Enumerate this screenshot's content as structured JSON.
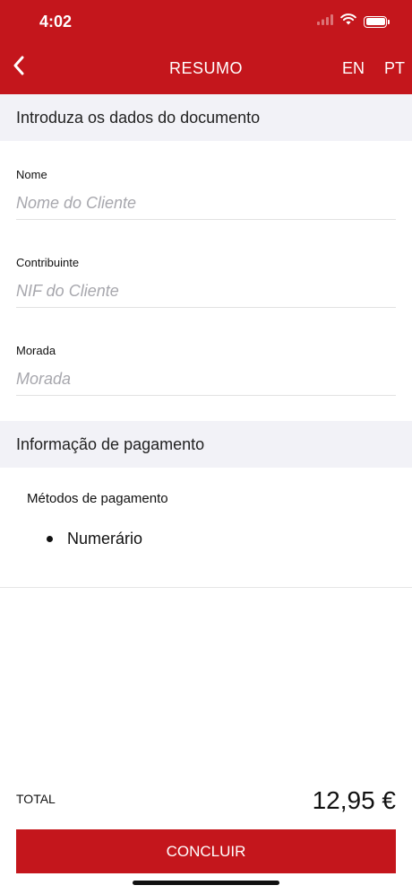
{
  "status_bar": {
    "time": "4:02"
  },
  "nav": {
    "title": "RESUMO",
    "lang_en": "EN",
    "lang_pt": "PT"
  },
  "document_section": {
    "header": "Introduza os dados do documento",
    "fields": [
      {
        "label": "Nome",
        "placeholder": "Nome do Cliente",
        "value": ""
      },
      {
        "label": "Contribuinte",
        "placeholder": "NIF do Cliente",
        "value": ""
      },
      {
        "label": "Morada",
        "placeholder": "Morada",
        "value": ""
      }
    ]
  },
  "payment_section": {
    "header": "Informação de pagamento",
    "methods_label": "Métodos de pagamento",
    "methods": [
      "Numerário"
    ]
  },
  "total": {
    "label": "TOTAL",
    "value": "12,95 €"
  },
  "action": {
    "conclude_label": "CONCLUIR"
  },
  "colors": {
    "brand": "#c4161c",
    "section_bg": "#f2f2f7"
  }
}
